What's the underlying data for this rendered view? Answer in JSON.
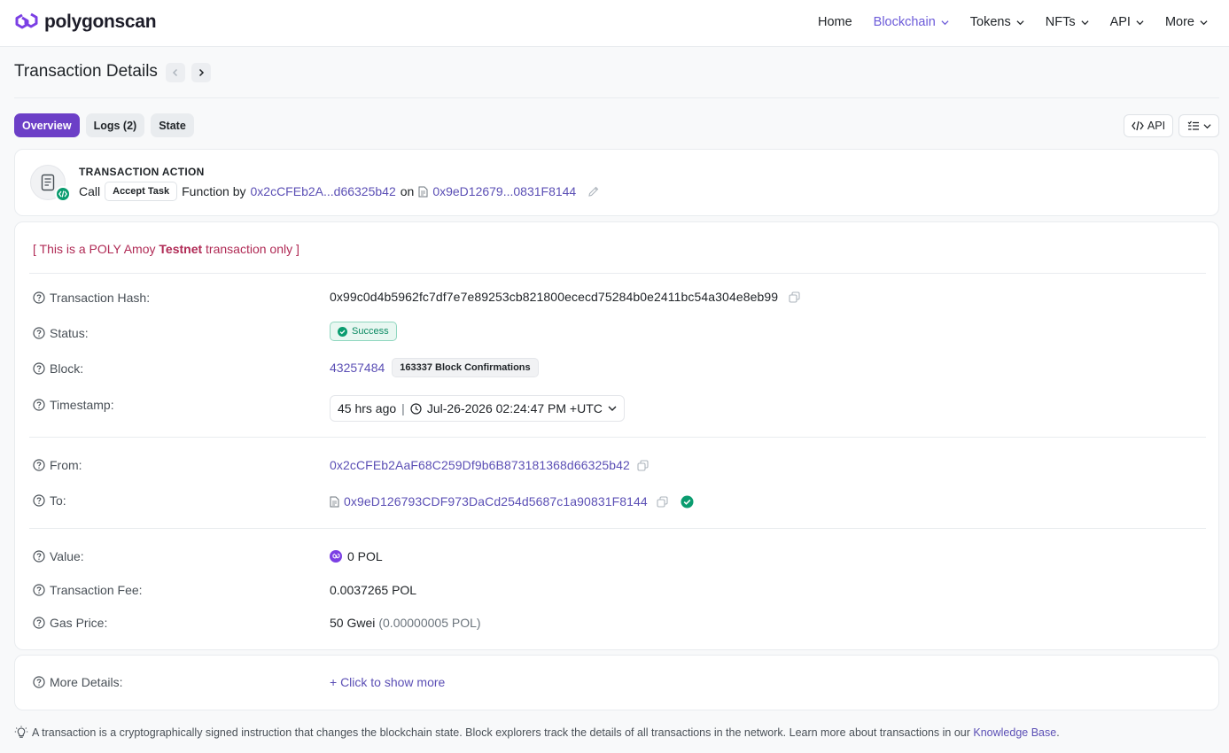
{
  "header": {
    "brand": "polygonscan",
    "nav": [
      {
        "label": "Home",
        "dropdown": false,
        "active": false
      },
      {
        "label": "Blockchain",
        "dropdown": true,
        "active": true
      },
      {
        "label": "Tokens",
        "dropdown": true,
        "active": false
      },
      {
        "label": "NFTs",
        "dropdown": true,
        "active": false
      },
      {
        "label": "API",
        "dropdown": true,
        "active": false
      },
      {
        "label": "More",
        "dropdown": true,
        "active": false
      }
    ]
  },
  "page": {
    "title": "Transaction Details",
    "prev_icon": "chevron-left-icon",
    "next_icon": "chevron-right-icon"
  },
  "tabs": [
    {
      "label": "Overview",
      "active": true
    },
    {
      "label": "Logs (2)",
      "active": false
    },
    {
      "label": "State",
      "active": false
    }
  ],
  "toolbar": {
    "api_label": "API"
  },
  "action": {
    "title": "TRANSACTION ACTION",
    "call": "Call",
    "method": "Accept Task",
    "function_by": "Function by",
    "from_short": "0x2cCFEb2A...d66325b42",
    "on": "on",
    "to_short": "0x9eD12679...0831F8144"
  },
  "notice": {
    "prefix": "[ This is a POLY Amoy ",
    "bold": "Testnet",
    "suffix": " transaction only ]"
  },
  "details": {
    "hash_label": "Transaction Hash:",
    "hash": "0x99c0d4b5962fc7df7e7e89253cb821800ececd75284b0e2411bc54a304e8eb99",
    "status_label": "Status:",
    "status": "Success",
    "block_label": "Block:",
    "block": "43257484",
    "confirmations": "163337 Block Confirmations",
    "timestamp_label": "Timestamp:",
    "timestamp_ago": "45 hrs ago",
    "timestamp_sep": "|",
    "timestamp": "Jul-26-2026 02:24:47 PM +UTC",
    "from_label": "From:",
    "from": "0x2cCFEb2AaF68C259Df9b6B873181368d66325b42",
    "to_label": "To:",
    "to": "0x9eD126793CDF973DaCd254d5687c1a90831F8144",
    "value_label": "Value:",
    "value": "0 POL",
    "fee_label": "Transaction Fee:",
    "fee": "0.0037265 POL",
    "gas_label": "Gas Price:",
    "gas": "50 Gwei",
    "gas_pol": "(0.00000005 POL)"
  },
  "more": {
    "label": "More Details:",
    "link": "+ Click to show more"
  },
  "footer": {
    "text": "A transaction is a cryptographically signed instruction that changes the blockchain state. Block explorers track the details of all transactions in the network. Learn more about transactions in our ",
    "link": "Knowledge Base",
    "end": "."
  },
  "colors": {
    "brand": "#6c3fc7",
    "link": "#5b4fb5",
    "success": "#0a8a62",
    "testnet": "#b02a55"
  }
}
